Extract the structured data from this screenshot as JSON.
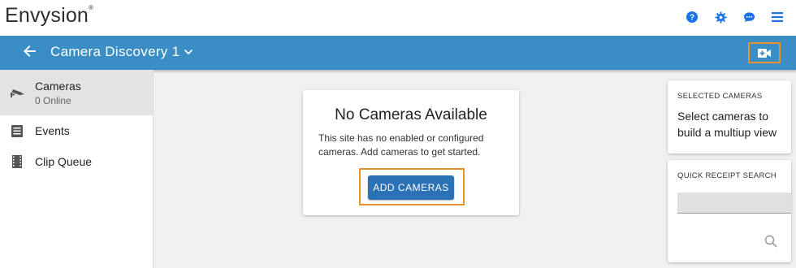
{
  "app": {
    "logo": "Envysion"
  },
  "header": {
    "icons": [
      "help-icon",
      "settings-icon",
      "chat-icon",
      "menu-icon"
    ],
    "accent": "#1a73e8"
  },
  "navbar": {
    "title": "Camera Discovery 1",
    "background": "#3a8dc5",
    "action_icon": "video-add-icon"
  },
  "sidebar": {
    "items": [
      {
        "label": "Cameras",
        "sub": "0 Online",
        "icon": "cctv-camera-icon",
        "active": true
      },
      {
        "label": "Events",
        "icon": "list-icon"
      },
      {
        "label": "Clip Queue",
        "icon": "film-icon"
      }
    ]
  },
  "empty_state": {
    "title": "No Cameras Available",
    "message": "This site has no enabled or configured cameras. Add cameras to get started.",
    "button": "ADD CAMERAS"
  },
  "selected_cameras": {
    "heading": "SELECTED CAMERAS",
    "body": "Select cameras to build a multiup view"
  },
  "quick_receipt": {
    "heading": "QUICK RECEIPT SEARCH",
    "value": "",
    "icon": "search-icon"
  }
}
